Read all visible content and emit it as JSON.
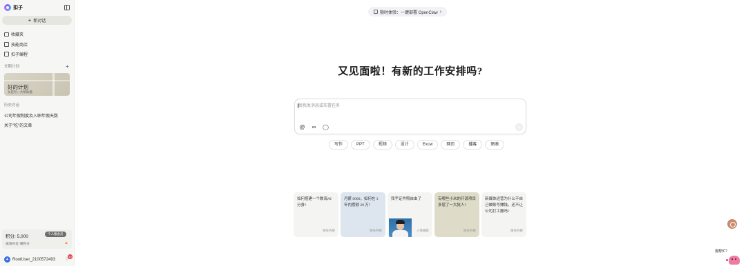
{
  "brand": {
    "name": "扣子",
    "logo_icon": "coze-logo-icon"
  },
  "sidebar": {
    "collapse_icon": "sidebar-collapse-icon",
    "new_chat_label": "新对话",
    "nav": [
      {
        "label": "收藏夹",
        "icon": "folder-icon"
      },
      {
        "label": "技能商店",
        "icon": "store-icon"
      },
      {
        "label": "扣子编程",
        "icon": "code-icon"
      }
    ],
    "plans_label": "长期计划",
    "plan_card": {
      "title": "好的计划",
      "subtitle": "总是有一大帮助着"
    },
    "history_label": "历史对话",
    "history": [
      "公司年假制度及入职年假天数",
      "关于\"吃\"的文章"
    ],
    "points": "积分: 5,000",
    "upgrade_label": "个人版会员",
    "invite_label": "邀请好友 赚积分",
    "user_name": "RootUser_2100572493",
    "notification_count": "10"
  },
  "promo": {
    "label": "限时体验：一键部署 OpenClaw"
  },
  "main": {
    "headline": "又见面啦！有新的工作安排吗?",
    "composer_placeholder": "给我发消息或布置任务",
    "chips": [
      "写作",
      "PPT",
      "视频",
      "设计",
      "Excel",
      "网页",
      "播客",
      "图表"
    ],
    "cards": [
      {
        "text": "如何搭建一个数海AI分身?",
        "cta": "做任务聊",
        "bg": "#f4f4f2"
      },
      {
        "text": "月薪 8000，如何在 3 年内攒够 20 万?",
        "cta": "做任务聊",
        "bg": "#dde5ee"
      },
      {
        "text": "拜手证件照自由了",
        "cta": "人像摄影",
        "bg": "#f4f4f2"
      },
      {
        "text": "有哪些小众的开源项目多层了一大批人?",
        "cta": "做任务聊",
        "bg": "#dedcc8"
      },
      {
        "text": "新媒体运营为什么不自己做账号赚钱，还不让公司打工搬吗?",
        "cta": "做任务聊",
        "bg": "#f4f4f2"
      }
    ]
  },
  "help_tip": "需帮忙?"
}
